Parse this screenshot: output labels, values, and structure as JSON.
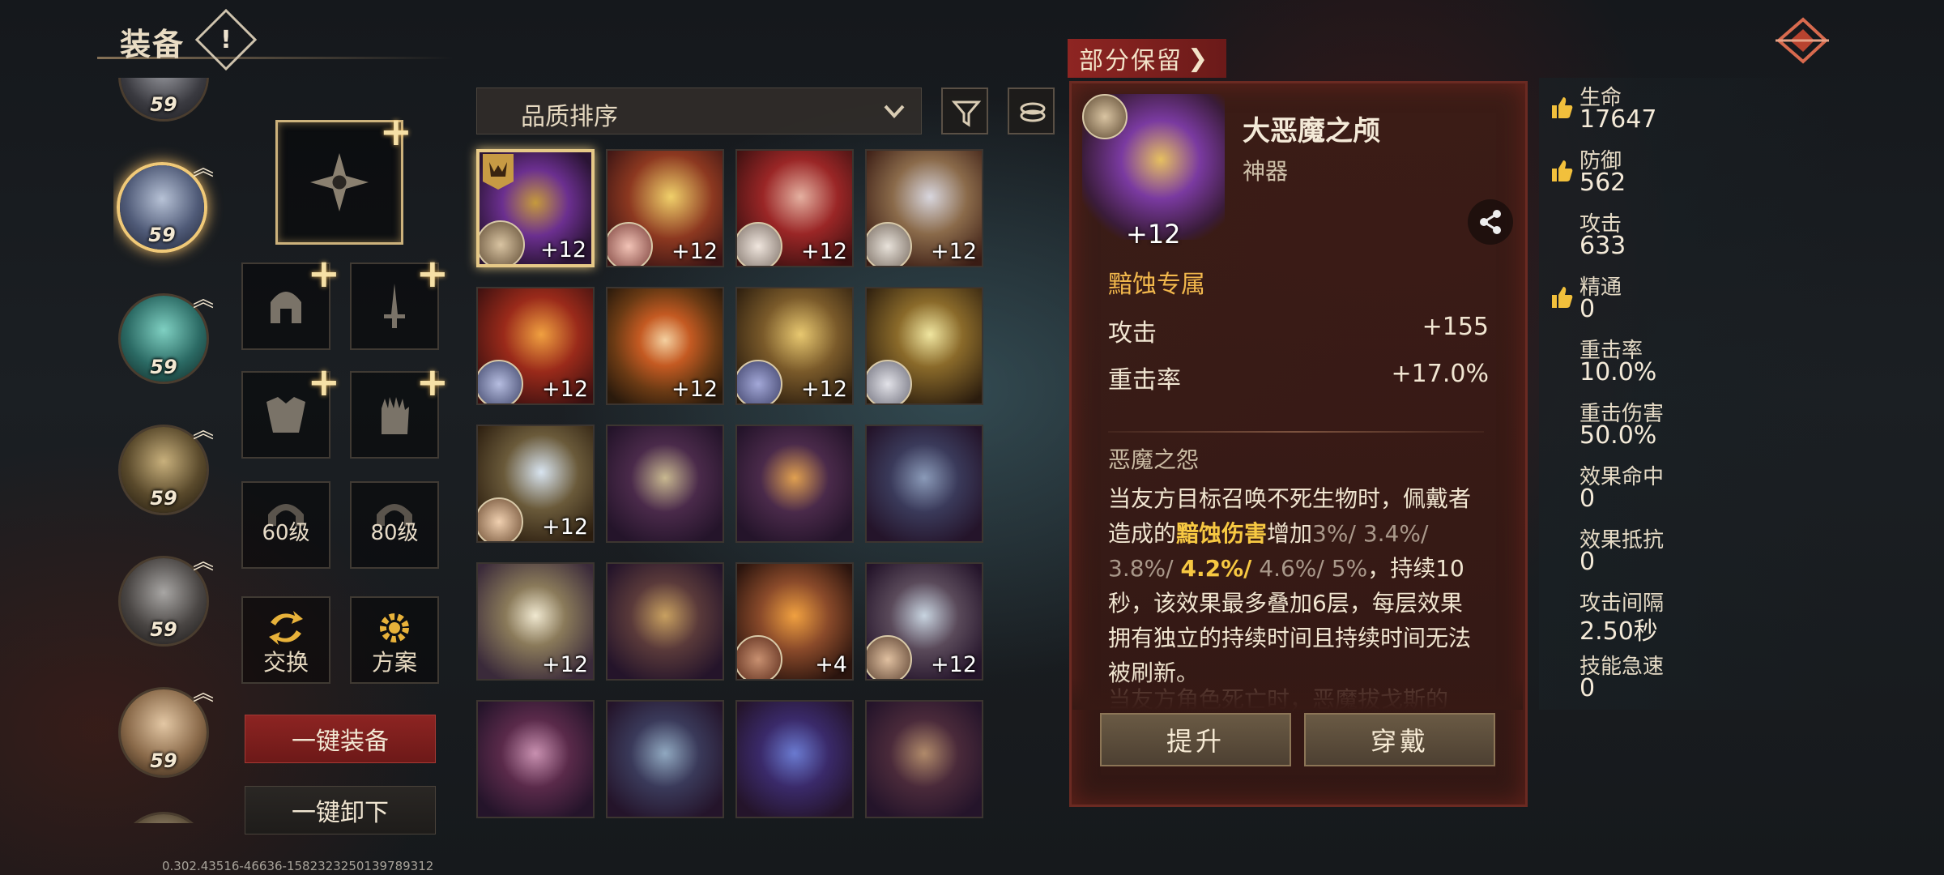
{
  "header": {
    "title": "装备",
    "info_icon": "!",
    "back_icon": "back-emblem-icon"
  },
  "heroes": [
    {
      "level": "59",
      "selected": false
    },
    {
      "level": "59",
      "selected": true
    },
    {
      "level": "59",
      "selected": false
    },
    {
      "level": "59",
      "selected": false
    },
    {
      "level": "59",
      "selected": false
    },
    {
      "level": "59",
      "selected": false
    }
  ],
  "equip_slots": {
    "level_60": "60级",
    "level_80": "80级",
    "swap": "交换",
    "preset": "方案",
    "plus_icon": "+"
  },
  "buttons": {
    "equip_all": "一键装备",
    "unequip_all": "一键卸下"
  },
  "version": "0.302.43516-46636-1582323250139789312",
  "sort": {
    "label": "品质排序"
  },
  "inventory": [
    {
      "enh": "+12",
      "name": "demon-helm",
      "selected": true,
      "owner": true
    },
    {
      "enh": "+12",
      "name": "golden-scepter",
      "owner": true
    },
    {
      "enh": "+12",
      "name": "eye-relic",
      "owner": true
    },
    {
      "enh": "+12",
      "name": "silver-breastplate",
      "owner": true
    },
    {
      "enh": "+12",
      "name": "flame-spear",
      "owner": true
    },
    {
      "enh": "+12",
      "name": "eyeball-orb",
      "owner": false
    },
    {
      "enh": "+12",
      "name": "golden-chalice",
      "owner": true
    },
    {
      "enh": "",
      "name": "candle",
      "owner": true
    },
    {
      "enh": "+12",
      "name": "crystal-mace",
      "owner": true
    },
    {
      "enh": "",
      "name": "bone",
      "owner": false
    },
    {
      "enh": "",
      "name": "fire-bow",
      "owner": false
    },
    {
      "enh": "",
      "name": "dark-cape",
      "owner": false
    },
    {
      "enh": "+12",
      "name": "holy-tome",
      "owner": false
    },
    {
      "enh": "",
      "name": "spinning-top",
      "owner": false
    },
    {
      "enh": "+4",
      "name": "fire-shield",
      "owner": true
    },
    {
      "enh": "+12",
      "name": "harp",
      "owner": true
    },
    {
      "enh": "",
      "name": "crystal-bloom",
      "owner": false
    },
    {
      "enh": "",
      "name": "war-banner",
      "owner": false
    },
    {
      "enh": "",
      "name": "gem-collar",
      "owner": false
    },
    {
      "enh": "",
      "name": "horns",
      "owner": false
    }
  ],
  "detail": {
    "banner": "部分保留",
    "item_name": "大恶魔之颅",
    "item_type": "神器",
    "enhance": "+12",
    "exclusive": "黯蚀专属",
    "stats": [
      {
        "label": "攻击",
        "value": "+155"
      },
      {
        "label": "重击率",
        "value": "+17.0%"
      }
    ],
    "skill_name": "恶魔之怨",
    "desc": {
      "p1": "当友方目标召唤不死生物时，佩戴者造成的",
      "highlight": "黯蚀伤害",
      "p2": "增加",
      "v1": "3%/",
      "v2": "3.4%/",
      "v3": "3.8%/",
      "v4": "4.2%/",
      "v5": "4.6%/",
      "v6": "5%",
      "p3": "，持续10秒，该效果最多叠加6层，每层效果拥有独立的持续时间且持续时间无法被刷新。"
    },
    "cut_off_text": "当友方角色死亡时，恶魔拔戈斯的",
    "upgrade_btn": "提升",
    "wear_btn": "穿戴"
  },
  "stats": [
    {
      "name": "生命",
      "value": "17647",
      "thumb": true
    },
    {
      "name": "防御",
      "value": "562",
      "thumb": true
    },
    {
      "name": "攻击",
      "value": "633",
      "thumb": false
    },
    {
      "name": "精通",
      "value": "0",
      "thumb": true
    },
    {
      "name": "重击率",
      "value": "10.0%",
      "thumb": false
    },
    {
      "name": "重击伤害",
      "value": "50.0%",
      "thumb": false
    },
    {
      "name": "效果命中",
      "value": "0",
      "thumb": false
    },
    {
      "name": "效果抵抗",
      "value": "0",
      "thumb": false
    },
    {
      "name": "攻击间隔",
      "value": "2.50秒",
      "thumb": false
    },
    {
      "name": "技能急速",
      "value": "0",
      "thumb": false
    }
  ],
  "colors": {
    "accent_red": "#8e2522",
    "highlight_gold": "#f7c842",
    "panel_bg": "#3c1c16"
  }
}
